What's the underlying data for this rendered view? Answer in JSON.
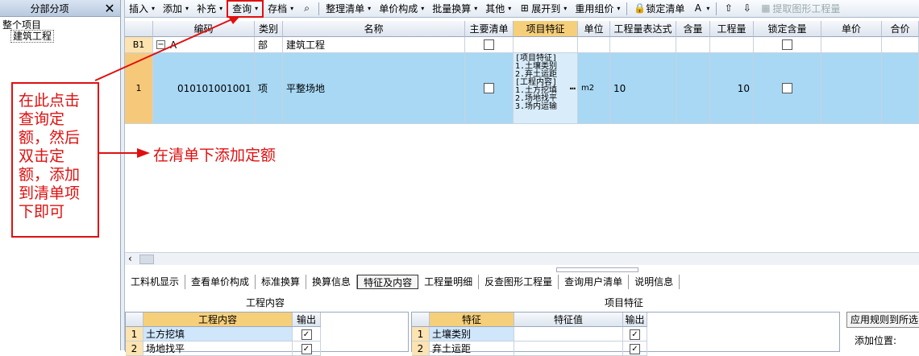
{
  "left_panel": {
    "title": "分部分项",
    "close": "✕",
    "tree": [
      "整个项目",
      "建筑工程"
    ]
  },
  "toolbar": [
    {
      "label": "插入",
      "dd": true
    },
    {
      "label": "添加",
      "dd": true
    },
    {
      "label": "补充",
      "dd": true
    },
    {
      "label": "查询",
      "dd": true,
      "highlight": true
    },
    {
      "label": "存档",
      "dd": true
    },
    {
      "icon": "binoculars-icon",
      "glyph": "⌕"
    },
    {
      "sep": true
    },
    {
      "label": "整理清单",
      "dd": true
    },
    {
      "label": "单价构成",
      "dd": true
    },
    {
      "label": "批量换算",
      "dd": true
    },
    {
      "label": "其他",
      "dd": true
    },
    {
      "label": "展开到",
      "dd": true,
      "icon": "expand-icon",
      "glyph": "⊞"
    },
    {
      "label": "重用组价",
      "dd": true
    },
    {
      "sep": true
    },
    {
      "label": "锁定清单",
      "icon": "lock-icon",
      "glyph": "🔒"
    },
    {
      "icon": "paint-icon",
      "glyph": "A",
      "dd": true
    },
    {
      "sep": true
    },
    {
      "icon": "up-arrow-icon",
      "glyph": "⇧"
    },
    {
      "icon": "down-arrow-icon",
      "glyph": "⇩"
    },
    {
      "label": "提取图形工程量",
      "icon": "extract-icon",
      "glyph": "▦",
      "disabled": true
    }
  ],
  "grid": {
    "headers": [
      "",
      "编码",
      "类别",
      "名称",
      "主要清单",
      "项目特征",
      "单位",
      "工程量表达式",
      "含量",
      "工程量",
      "锁定含量",
      "单价",
      "合价"
    ],
    "rows": [
      {
        "num": "B1",
        "code": "A",
        "type": "部",
        "name": "建筑工程",
        "main": true,
        "feature": "",
        "unit": "",
        "expr": "",
        "content": "",
        "qty": "",
        "lock": true
      },
      {
        "num": "1",
        "code": "010101001001",
        "type": "项",
        "name": "平整场地",
        "main": true,
        "feature": "[项目特征]\n1.土壤类别\n2.弃土运距\n[工程内容]\n1.土方挖填\n2.场地找平\n3.场内运输",
        "feature_more": "…",
        "unit": "m2",
        "expr": "10",
        "content": "",
        "qty": "10",
        "lock": true
      }
    ]
  },
  "bottom_tabs": [
    "工料机显示",
    "查看单价构成",
    "标准换算",
    "换算信息",
    "特征及内容",
    "工程量明细",
    "反查图形工程量",
    "查询用户清单",
    "说明信息"
  ],
  "active_tab": "特征及内容",
  "work_content": {
    "title": "工程内容",
    "headers": [
      "",
      "工程内容",
      "输出"
    ],
    "rows": [
      {
        "num": "1",
        "text": "土方挖填",
        "checked": true
      },
      {
        "num": "2",
        "text": "场地找平",
        "checked": true
      }
    ]
  },
  "project_feature": {
    "title": "项目特征",
    "headers": [
      "",
      "特征",
      "特征值",
      "输出"
    ],
    "rows": [
      {
        "num": "1",
        "text": "土壤类别",
        "value": "",
        "checked": true
      },
      {
        "num": "2",
        "text": "弃土运距",
        "value": "",
        "checked": true
      }
    ]
  },
  "apply_button": "应用规则到所选",
  "add_position": "添加位置:",
  "annotations": {
    "callout": "在此点击查询定额，然后双击定额，添加到清单项下即可",
    "note": "在清单下添加定额"
  },
  "colors": {
    "annotation": "#e01010",
    "selected_row": "#a8d8f4",
    "header_selected": "#f6cf7a"
  }
}
